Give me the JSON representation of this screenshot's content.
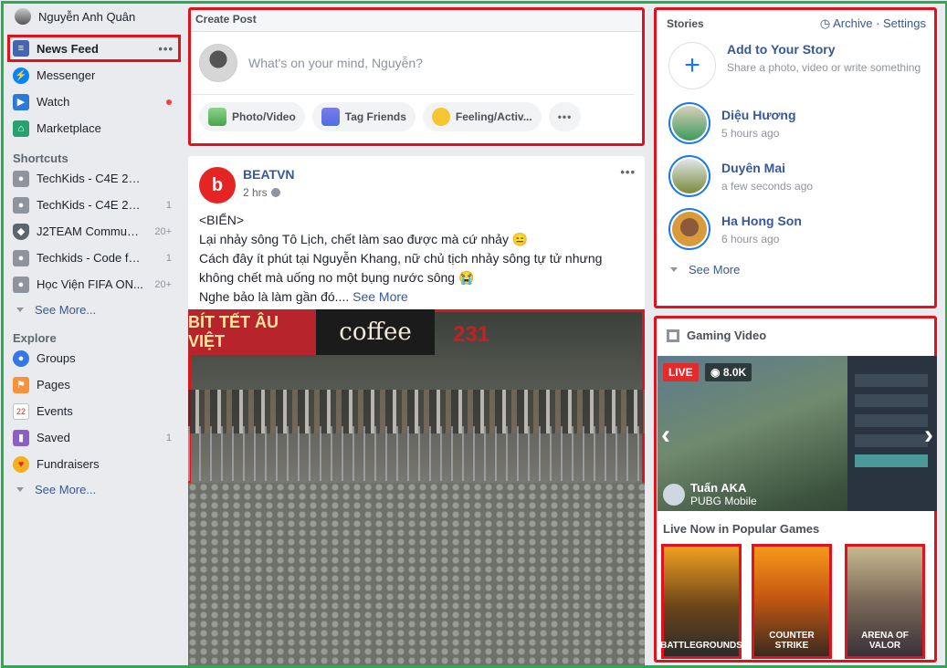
{
  "user": {
    "name": "Nguyễn Anh Quân"
  },
  "nav": {
    "news_feed": "News Feed",
    "messenger": "Messenger",
    "watch": "Watch",
    "marketplace": "Marketplace",
    "more_dots": "•••"
  },
  "shortcuts": {
    "heading": "Shortcuts",
    "items": [
      {
        "label": "TechKids - C4E 22 ...",
        "count": ""
      },
      {
        "label": "TechKids - C4E 23 ...",
        "count": "1"
      },
      {
        "label": "J2TEAM Community",
        "count": "20+"
      },
      {
        "label": "Techkids - Code for...",
        "count": "1"
      },
      {
        "label": "Học Viện FIFA ON...",
        "count": "20+"
      }
    ],
    "see_more": "See More..."
  },
  "explore": {
    "heading": "Explore",
    "items": [
      {
        "label": "Groups",
        "count": ""
      },
      {
        "label": "Pages",
        "count": ""
      },
      {
        "label": "Events",
        "count": ""
      },
      {
        "label": "Saved",
        "count": "1"
      },
      {
        "label": "Fundraisers",
        "count": ""
      }
    ],
    "see_more": "See More..."
  },
  "create_post": {
    "title": "Create Post",
    "placeholder": "What's on your mind, Nguyễn?",
    "photo_video": "Photo/Video",
    "tag_friends": "Tag Friends",
    "feeling": "Feeling/Activ...",
    "more": "•••"
  },
  "post": {
    "page_name": "BEATVN",
    "time": "2 hrs",
    "more": "•••",
    "line1": "<BIỂN>",
    "line2": "Lại nhảy sông Tô Lịch, chết làm sao được mà cứ nhảy 😑",
    "line3": "Cách đây ít phút tại Nguyễn Khang, nữ chủ tịch nhảy sông tự tử nhưng không chết mà uống no một bụng nước sông 😭",
    "line4": "Nghe bảo là làm gần đó....",
    "see_more": "See More",
    "sign_left": "BÍT TẾT ÂU VIỆT",
    "sign_mid": "coffee",
    "sign_right": "231"
  },
  "stories": {
    "title": "Stories",
    "archive": "Archive",
    "settings": "Settings",
    "separator": " · ",
    "add": {
      "title": "Add to Your Story",
      "subtitle": "Share a photo, video or write something"
    },
    "items": [
      {
        "name": "Diệu Hương",
        "time": "5 hours ago"
      },
      {
        "name": "Duyên Mai",
        "time": "a few seconds ago"
      },
      {
        "name": "Ha Hong Son",
        "time": "6 hours ago"
      }
    ],
    "see_more": "See More"
  },
  "gaming": {
    "title": "Gaming Video",
    "live": "LIVE",
    "views": "8.0K",
    "streamer": "Tuấn AKA",
    "game": "PUBG Mobile",
    "live_now_title": "Live Now in Popular Games",
    "games": [
      "BATTLEGROUNDS",
      "COUNTER STRIKE",
      "ARENA OF VALOR"
    ]
  },
  "colors": {
    "accent": "#385898",
    "highlight_border": "#e0121b",
    "frame_border": "#22b14c",
    "live_red": "#e42b2b"
  }
}
